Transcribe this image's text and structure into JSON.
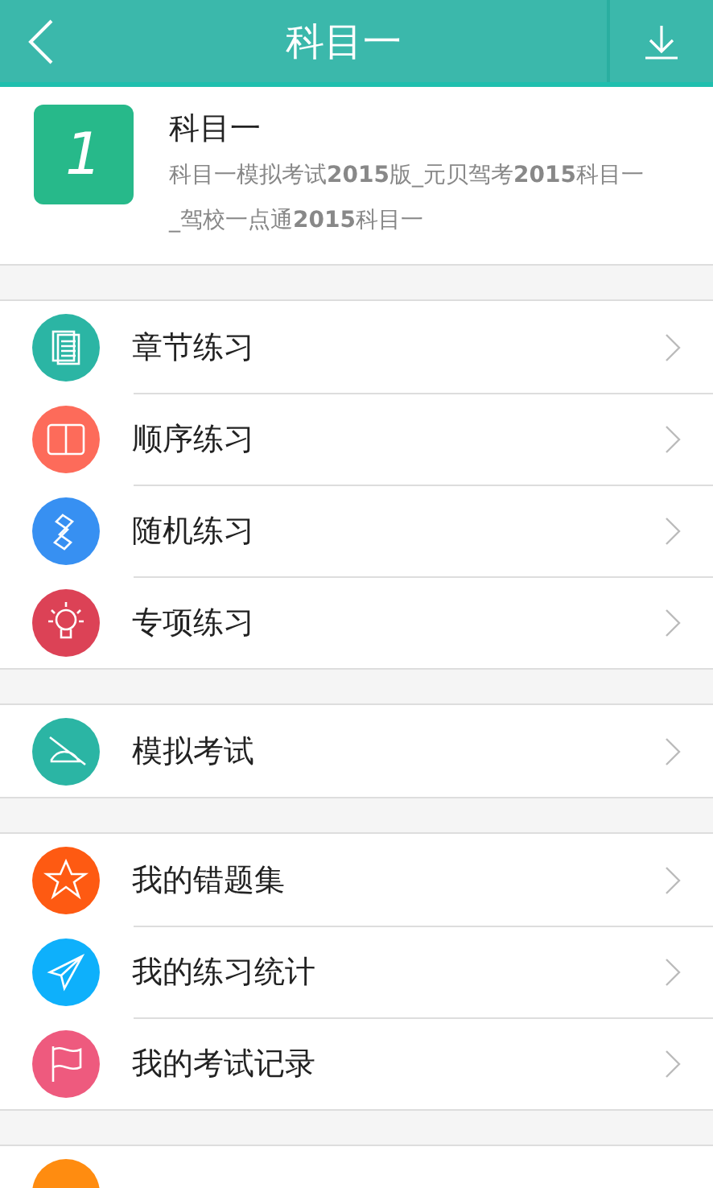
{
  "header": {
    "title": "科目一"
  },
  "subject": {
    "badge": "1",
    "name": "科目一",
    "description": "科目一模拟考试**2015**版_元贝驾考**2015**科目一_驾校一点通**2015**科目一"
  },
  "groups": [
    {
      "items": [
        {
          "label": "章节练习",
          "kind": "pages",
          "color": "#2bb5a4"
        },
        {
          "label": "顺序练习",
          "kind": "book",
          "color": "#fd6b5a"
        },
        {
          "label": "随机练习",
          "kind": "link",
          "color": "#3790f2"
        },
        {
          "label": "专项练习",
          "kind": "bulb",
          "color": "#dc4256"
        }
      ]
    },
    {
      "items": [
        {
          "label": "模拟考试",
          "kind": "pen",
          "color": "#2bb5a4"
        }
      ]
    },
    {
      "items": [
        {
          "label": "我的错题集",
          "kind": "star",
          "color": "#fe5a12"
        },
        {
          "label": "我的练习统计",
          "kind": "plane",
          "color": "#0eb0fb"
        },
        {
          "label": "我的考试记录",
          "kind": "flag",
          "color": "#ee5a7e"
        }
      ]
    },
    {
      "items": [
        {
          "kind": "blank",
          "color": "#ff8c10"
        }
      ]
    }
  ]
}
